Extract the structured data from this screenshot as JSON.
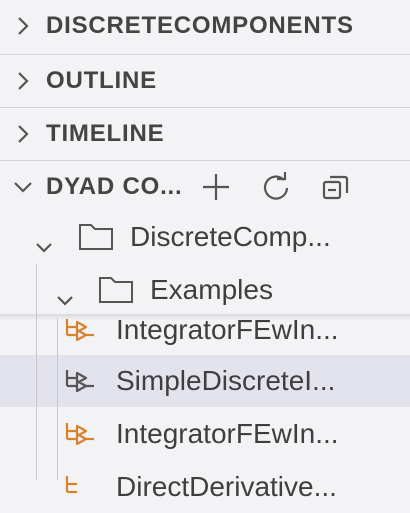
{
  "sections": {
    "discrete_components": "DISCRETECOMPONENTS",
    "outline": "OUTLINE",
    "timeline": "TIMELINE",
    "dyad": "DYAD CO..."
  },
  "icons": {
    "collapsed": "chevron-right-icon",
    "expanded": "chevron-down-icon",
    "add": "plus-icon",
    "refresh": "refresh-icon",
    "collapse_all": "collapse-all-icon",
    "folder": "folder-icon",
    "component": "component-icon"
  },
  "tree": {
    "root_folder": "DiscreteComp...",
    "examples_folder": "Examples",
    "items": [
      {
        "label": "IntegratorFEwIn...",
        "icon_color": "#d9822b"
      },
      {
        "label": "SimpleDiscreteI...",
        "icon_color": "#555555"
      },
      {
        "label": "IntegratorFEwIn...",
        "icon_color": "#d9822b"
      },
      {
        "label": "DirectDerivative...",
        "icon_color": "#d9822b"
      }
    ]
  },
  "colors": {
    "background": "#f3f3f6",
    "selection": "#e3e3ee",
    "accent_orange": "#d9822b"
  }
}
